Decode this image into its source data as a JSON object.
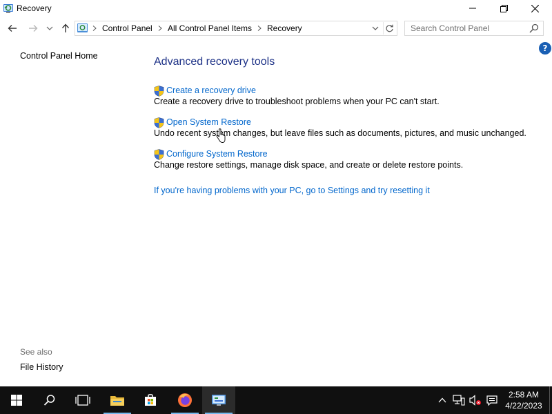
{
  "window": {
    "title": "Recovery",
    "app_icon": "recovery-icon",
    "controls": [
      "minimize-icon",
      "maximize-icon",
      "close-icon"
    ]
  },
  "nav": {
    "back_icon": "back-arrow-icon",
    "forward_icon": "forward-arrow-icon",
    "recent_icon": "chevron-down-icon",
    "up_icon": "up-arrow-icon"
  },
  "address": {
    "crumbs": [
      "Control Panel",
      "All Control Panel Items",
      "Recovery"
    ],
    "refresh_icon": "refresh-icon"
  },
  "search": {
    "placeholder": "Search Control Panel"
  },
  "sidebar": {
    "home_label": "Control Panel Home",
    "see_also_label": "See also",
    "see_also_items": [
      "File History"
    ]
  },
  "main": {
    "heading": "Advanced recovery tools",
    "tools": [
      {
        "label": "Create a recovery drive",
        "description": "Create a recovery drive to troubleshoot problems when your PC can't start."
      },
      {
        "label": "Open System Restore",
        "description": "Undo recent system changes, but leave files such as documents, pictures, and music unchanged."
      },
      {
        "label": "Configure System Restore",
        "description": "Change restore settings, manage disk space, and create or delete restore points."
      }
    ],
    "reset_link": "If you're having problems with your PC, go to Settings and try resetting it"
  },
  "taskbar": {
    "items": [
      "windows-start-icon",
      "search-icon",
      "task-view-icon",
      "file-explorer-icon",
      "store-icon",
      "firefox-icon",
      "control-panel-icon"
    ],
    "active_item": "control-panel-icon",
    "tray": [
      "chevron-up-icon",
      "network-icon",
      "volume-muted-icon",
      "action-center-icon"
    ],
    "time": "2:58 AM",
    "date": "4/22/2023"
  },
  "colors": {
    "heading": "#1e3287",
    "link": "#0066cc",
    "taskbar": "#101010",
    "accent": "#76b9ed"
  }
}
